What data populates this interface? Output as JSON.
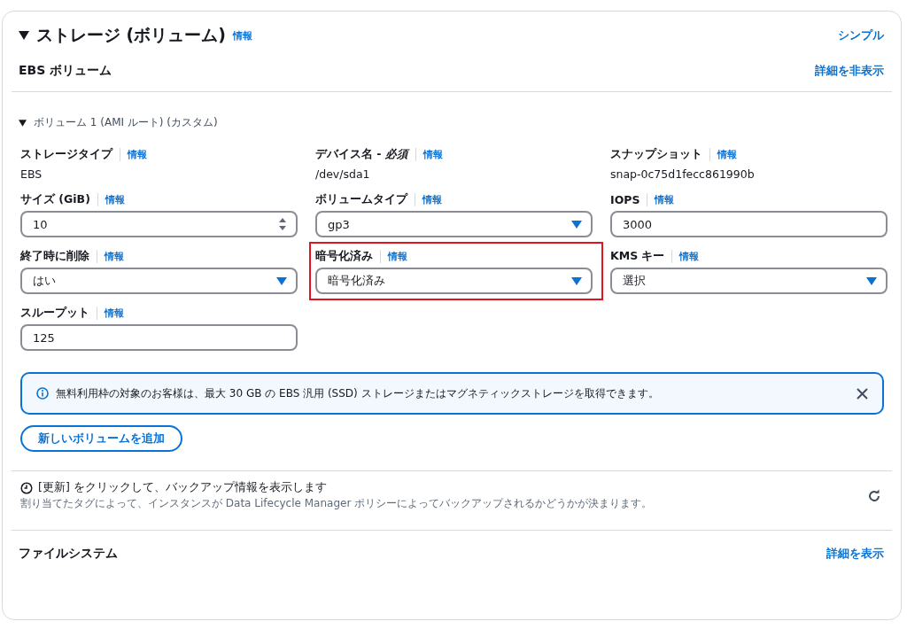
{
  "header": {
    "expanded": true,
    "title": "ストレージ (ボリューム)",
    "info": "情報",
    "mode_link": "シンプル"
  },
  "ebs": {
    "title": "EBS ボリューム",
    "toggle_link": "詳細を非表示"
  },
  "volume": {
    "expanded": true,
    "title": "ボリューム 1 (AMI ルート) (カスタム)"
  },
  "fields": [
    {
      "kind": "static",
      "label": "ストレージタイプ",
      "info": "情報",
      "value": "EBS",
      "highlighted": false
    },
    {
      "kind": "static",
      "label": "デバイス名 - *必須*",
      "info": "情報",
      "value": "/dev/sda1",
      "highlighted": false
    },
    {
      "kind": "static",
      "label": "スナップショット",
      "info": "情報",
      "value": "snap-0c75d1fecc861990b",
      "highlighted": false
    },
    {
      "kind": "number",
      "label": "サイズ (GiB)",
      "info": "情報",
      "value": "10",
      "highlighted": false
    },
    {
      "kind": "select",
      "label": "ボリュームタイプ",
      "info": "情報",
      "value": "gp3",
      "highlighted": false
    },
    {
      "kind": "input",
      "label": "IOPS",
      "info": "情報",
      "value": "3000",
      "highlighted": false
    },
    {
      "kind": "select",
      "label": "終了時に削除",
      "info": "情報",
      "value": "はい",
      "highlighted": false
    },
    {
      "kind": "select",
      "label": "暗号化済み",
      "info": "情報",
      "value": "暗号化済み",
      "highlighted": true
    },
    {
      "kind": "select",
      "label": "KMS キー",
      "info": "情報",
      "value": "選択",
      "highlighted": false
    },
    {
      "kind": "input",
      "label": "スループット",
      "info": "情報",
      "value": "125",
      "highlighted": false
    }
  ],
  "alert": {
    "text": "無料利用枠の対象のお客様は、最大 30 GB の EBS 汎用 (SSD) ストレージまたはマグネティックストレージを取得できます。"
  },
  "add_button": "新しいボリュームを追加",
  "backup": {
    "title": "[更新] をクリックして、バックアップ情報を表示します",
    "description": "割り当てたタグによって、インスタンスが Data Lifecycle Manager ポリシーによってバックアップされるかどうかが決まります。"
  },
  "filesystem": {
    "title": "ファイルシステム",
    "toggle_link": "詳細を表示"
  }
}
